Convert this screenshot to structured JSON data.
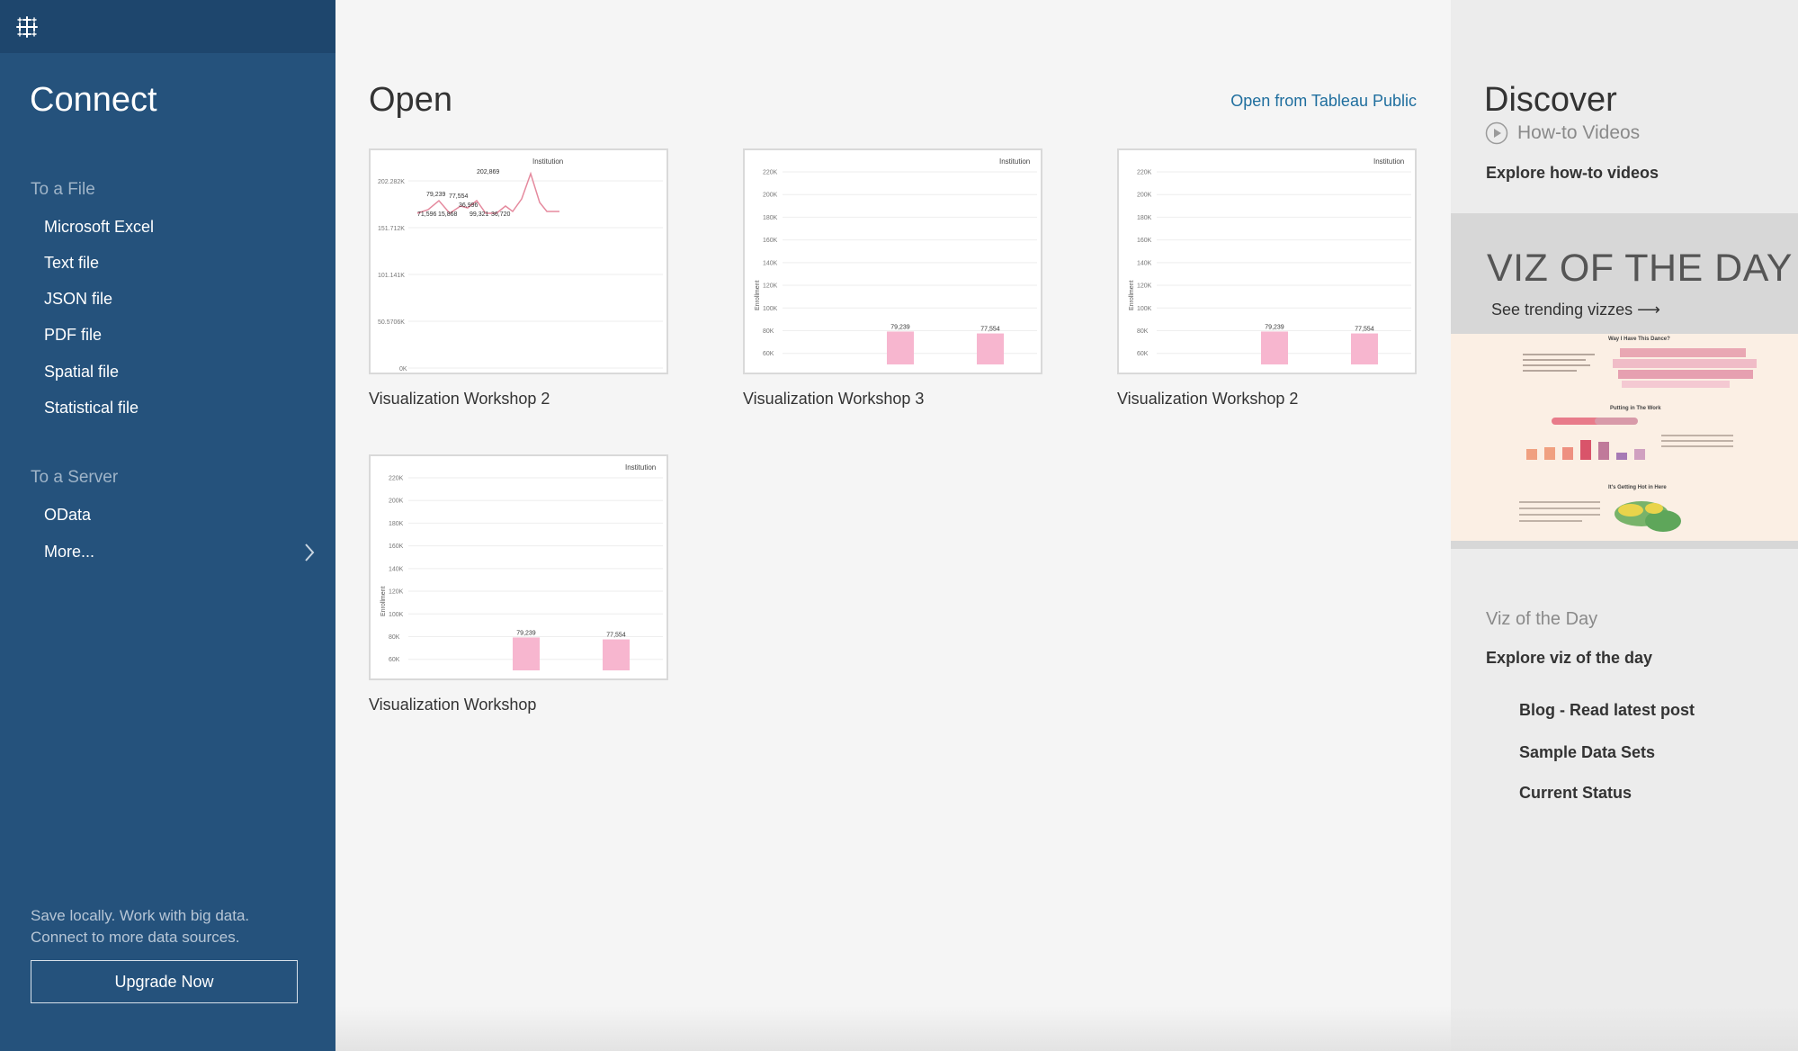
{
  "sidebar": {
    "title": "Connect",
    "file_section": {
      "heading": "To a File",
      "items": [
        "Microsoft Excel",
        "Text file",
        "JSON file",
        "PDF file",
        "Spatial file",
        "Statistical file"
      ]
    },
    "server_section": {
      "heading": "To a Server",
      "items": [
        "OData",
        "More..."
      ]
    },
    "promo_line1": "Save locally. Work with big data.",
    "promo_line2": "Connect to more data sources.",
    "upgrade_label": "Upgrade Now",
    "colors": {
      "background": "#25527c",
      "topbar": "#1e466d"
    }
  },
  "open": {
    "title": "Open",
    "public_link": "Open from Tableau Public",
    "workbooks": [
      {
        "name": "Visualization Workshop 2",
        "thumb": {
          "type": "line",
          "legend": "Institution",
          "yticks": [
            "202.282K",
            "151.712K",
            "101.141K",
            "50.5706K",
            "0K"
          ],
          "labels": [
            "79,239",
            "77,554",
            "202,869",
            "36,996",
            "71,596",
            "15,868",
            "99,321",
            "36,720"
          ]
        }
      },
      {
        "name": "Visualization Workshop 3",
        "thumb": {
          "type": "bar",
          "legend": "Institution",
          "ylabel": "Enrollment",
          "yticks": [
            "220K",
            "200K",
            "180K",
            "160K",
            "140K",
            "120K",
            "100K",
            "80K",
            "60K"
          ],
          "bars": [
            79239,
            77554
          ]
        }
      },
      {
        "name": "Visualization Workshop 2",
        "thumb": {
          "type": "bar",
          "legend": "Institution",
          "ylabel": "Enrollment",
          "yticks": [
            "220K",
            "200K",
            "180K",
            "160K",
            "140K",
            "120K",
            "100K",
            "80K",
            "60K"
          ],
          "bars": [
            79239,
            77554
          ]
        }
      },
      {
        "name": "Visualization Workshop",
        "thumb": {
          "type": "bar",
          "legend": "Institution",
          "ylabel": "Enrollment",
          "yticks": [
            "220K",
            "200K",
            "180K",
            "160K",
            "140K",
            "120K",
            "100K",
            "80K",
            "60K"
          ],
          "bars": [
            79239,
            77554
          ]
        }
      }
    ],
    "accent_color": "#1f6e9e",
    "chart_color": "#f7b6cf"
  },
  "discover": {
    "title": "Discover",
    "videos_heading": "How-to Videos",
    "videos_link": "Explore how-to videos",
    "votd_title": "VIZ OF THE DAY",
    "votd_trending": "See trending vizzes ⟶",
    "votd_image_text": {
      "heading": "Way I Have This Dance?",
      "section2": "Putting in The Work",
      "section3": "It's Getting Hot in Here"
    },
    "votd_heading": "Viz of the Day",
    "votd_link": "Explore viz of the day",
    "resources": [
      "Blog - Read latest post",
      "Sample Data Sets",
      "Current Status"
    ]
  }
}
